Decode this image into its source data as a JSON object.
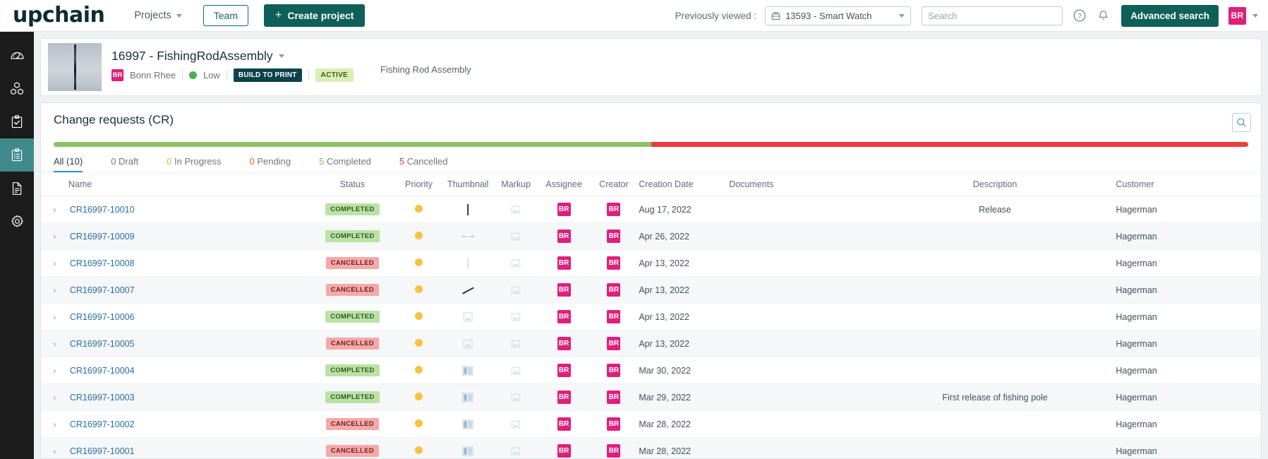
{
  "topbar": {
    "logo": "upchain",
    "projects_label": "Projects",
    "team_label": "Team",
    "create_label": "Create project",
    "previously_viewed_label": "Previously viewed :",
    "selected_project": "13593 - Smart Watch",
    "search_placeholder": "Search",
    "search_value": "",
    "advanced_search_label": "Advanced search",
    "avatar_initials": "BR"
  },
  "sidebar": {
    "items": [
      {
        "name": "dashboard",
        "icon": "gauge-icon",
        "active": false
      },
      {
        "name": "parts",
        "icon": "cubes-icon",
        "active": false
      },
      {
        "name": "tasks",
        "icon": "clipboard-check-icon",
        "active": false
      },
      {
        "name": "change-requests",
        "icon": "clipboard-list-icon",
        "active": true
      },
      {
        "name": "documents",
        "icon": "document-icon",
        "active": false
      },
      {
        "name": "settings",
        "icon": "gear-icon",
        "active": false
      }
    ]
  },
  "project": {
    "title": "16997 - FishingRodAssembly",
    "owner_initials": "BR",
    "owner_name": "Bonn Rhee",
    "priority": "Low",
    "process_chip": "BUILD TO PRINT",
    "status_chip": "ACTIVE",
    "description": "Fishing Rod Assembly"
  },
  "panel": {
    "title": "Change requests (CR)",
    "progress": [
      {
        "label": "completed",
        "color": "#8cc264",
        "percent": 50
      },
      {
        "label": "cancelled",
        "color": "#ee3b3b",
        "percent": 50
      }
    ],
    "tabs": [
      {
        "num": "",
        "label": "All (10)",
        "num_color": "#6a787f",
        "active": true
      },
      {
        "num": "0",
        "label": "Draft",
        "num_color": "#6a787f",
        "active": false
      },
      {
        "num": "0",
        "label": "In Progress",
        "num_color": "#f0b429",
        "active": false
      },
      {
        "num": "0",
        "label": "Pending",
        "num_color": "#e8662a",
        "active": false
      },
      {
        "num": "5",
        "label": "Completed",
        "num_color": "#7ebe5a",
        "active": false
      },
      {
        "num": "5",
        "label": "Cancelled",
        "num_color": "#e23c3c",
        "active": false
      }
    ],
    "columns": [
      "Name",
      "Status",
      "Priority",
      "Thumbnail",
      "Markup",
      "Assignee",
      "Creator",
      "Creation Date",
      "Documents",
      "Description",
      "Customer"
    ],
    "rows": [
      {
        "name": "CR16997-10010",
        "status": "COMPLETED",
        "priority": "medium",
        "thumbnail": "rod-vertical",
        "markup": "image-placeholder",
        "assignee": "BR",
        "creator": "BR",
        "date": "Aug 17, 2022",
        "documents": "",
        "description": "Release",
        "customer": "Hagerman"
      },
      {
        "name": "CR16997-10009",
        "status": "COMPLETED",
        "priority": "medium",
        "thumbnail": "rod-horizontal",
        "markup": "image-placeholder",
        "assignee": "BR",
        "creator": "BR",
        "date": "Apr 26, 2022",
        "documents": "",
        "description": "",
        "customer": "Hagerman"
      },
      {
        "name": "CR16997-10008",
        "status": "CANCELLED",
        "priority": "medium",
        "thumbnail": "rod-thin",
        "markup": "image-placeholder",
        "assignee": "BR",
        "creator": "BR",
        "date": "Apr 13, 2022",
        "documents": "",
        "description": "",
        "customer": "Hagerman"
      },
      {
        "name": "CR16997-10007",
        "status": "CANCELLED",
        "priority": "medium",
        "thumbnail": "rod-diagonal",
        "markup": "image-placeholder",
        "assignee": "BR",
        "creator": "BR",
        "date": "Apr 13, 2022",
        "documents": "",
        "description": "",
        "customer": "Hagerman"
      },
      {
        "name": "CR16997-10006",
        "status": "COMPLETED",
        "priority": "medium",
        "thumbnail": "image-placeholder",
        "markup": "image-placeholder",
        "assignee": "BR",
        "creator": "BR",
        "date": "Apr 13, 2022",
        "documents": "",
        "description": "",
        "customer": "Hagerman"
      },
      {
        "name": "CR16997-10005",
        "status": "CANCELLED",
        "priority": "medium",
        "thumbnail": "image-placeholder",
        "markup": "image-placeholder",
        "assignee": "BR",
        "creator": "BR",
        "date": "Apr 13, 2022",
        "documents": "",
        "description": "",
        "customer": "Hagerman"
      },
      {
        "name": "CR16997-10004",
        "status": "COMPLETED",
        "priority": "medium",
        "thumbnail": "blue-part",
        "markup": "image-placeholder",
        "assignee": "BR",
        "creator": "BR",
        "date": "Mar 30, 2022",
        "documents": "",
        "description": "",
        "customer": "Hagerman"
      },
      {
        "name": "CR16997-10003",
        "status": "COMPLETED",
        "priority": "medium",
        "thumbnail": "blue-part",
        "markup": "image-placeholder",
        "assignee": "BR",
        "creator": "BR",
        "date": "Mar 29, 2022",
        "documents": "",
        "description": "First release of fishing pole",
        "customer": "Hagerman"
      },
      {
        "name": "CR16997-10002",
        "status": "CANCELLED",
        "priority": "medium",
        "thumbnail": "blue-part",
        "markup": "image-placeholder",
        "assignee": "BR",
        "creator": "BR",
        "date": "Mar 28, 2022",
        "documents": "",
        "description": "",
        "customer": "Hagerman"
      },
      {
        "name": "CR16997-10001",
        "status": "CANCELLED",
        "priority": "medium",
        "thumbnail": "blue-part",
        "markup": "image-placeholder",
        "assignee": "BR",
        "creator": "BR",
        "date": "Mar 28, 2022",
        "documents": "",
        "description": "",
        "customer": "Hagerman"
      }
    ]
  },
  "colors": {
    "brand_dark": "#0d2b33",
    "brand_teal": "#0d6159",
    "accent_pink": "#e01f7b",
    "active_tab": "#2196d6",
    "completed": "#b9e3a4",
    "cancelled": "#f7a8a8",
    "priority_medium": "#f5c343"
  }
}
